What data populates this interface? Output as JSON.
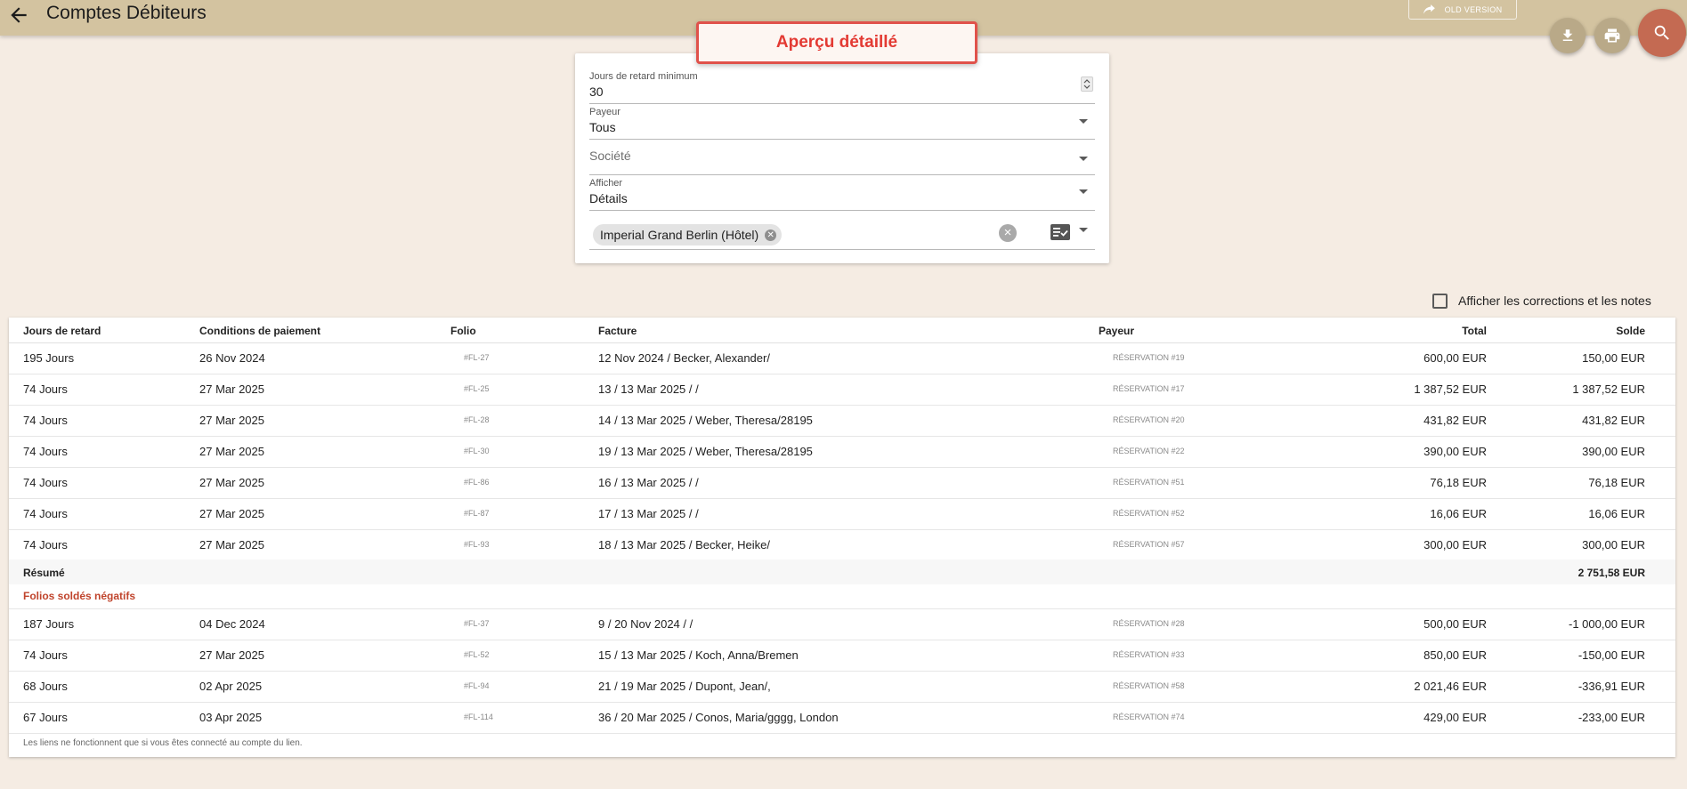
{
  "header": {
    "title": "Comptes Débiteurs",
    "old_version_label": "OLD VERSION"
  },
  "callout": {
    "text": "Aperçu détaillé"
  },
  "filters": {
    "min_days": {
      "label": "Jours de retard minimum",
      "value": "30"
    },
    "payer": {
      "label": "Payeur",
      "value": "Tous"
    },
    "company": {
      "placeholder": "Société"
    },
    "display": {
      "label": "Afficher",
      "value": "Détails"
    },
    "property_chip": "Imperial Grand Berlin (Hôtel)"
  },
  "show_notes_checkbox": {
    "label": "Afficher les corrections et les notes",
    "checked": false
  },
  "table": {
    "columns": [
      "Jours de retard",
      "Conditions de paiement",
      "Folio",
      "Facture",
      "Payeur",
      "Total",
      "Solde"
    ],
    "rows": [
      {
        "days": "195 Jours",
        "terms": "26 Nov 2024",
        "folio": "#FL-27",
        "invoice": "12 Nov 2024 / Becker, Alexander/",
        "payer": "RÉSERVATION #19",
        "total": "600,00 EUR",
        "balance": "150,00 EUR"
      },
      {
        "days": "74 Jours",
        "terms": "27 Mar 2025",
        "folio": "#FL-25",
        "invoice": "13 / 13 Mar 2025 / /",
        "payer": "RÉSERVATION #17",
        "total": "1 387,52 EUR",
        "balance": "1 387,52 EUR"
      },
      {
        "days": "74 Jours",
        "terms": "27 Mar 2025",
        "folio": "#FL-28",
        "invoice": "14 / 13 Mar 2025 / Weber, Theresa/28195",
        "payer": "RÉSERVATION #20",
        "total": "431,82 EUR",
        "balance": "431,82 EUR"
      },
      {
        "days": "74 Jours",
        "terms": "27 Mar 2025",
        "folio": "#FL-30",
        "invoice": "19 / 13 Mar 2025 / Weber, Theresa/28195",
        "payer": "RÉSERVATION #22",
        "total": "390,00 EUR",
        "balance": "390,00 EUR"
      },
      {
        "days": "74 Jours",
        "terms": "27 Mar 2025",
        "folio": "#FL-86",
        "invoice": "16 / 13 Mar 2025 / /",
        "payer": "RÉSERVATION #51",
        "total": "76,18 EUR",
        "balance": "76,18 EUR"
      },
      {
        "days": "74 Jours",
        "terms": "27 Mar 2025",
        "folio": "#FL-87",
        "invoice": "17 / 13 Mar 2025 / /",
        "payer": "RÉSERVATION #52",
        "total": "16,06 EUR",
        "balance": "16,06 EUR"
      },
      {
        "days": "74 Jours",
        "terms": "27 Mar 2025",
        "folio": "#FL-93",
        "invoice": "18 / 13 Mar 2025 / Becker, Heike/",
        "payer": "RÉSERVATION #57",
        "total": "300,00 EUR",
        "balance": "300,00 EUR"
      }
    ],
    "summary": {
      "label": "Résumé",
      "total": "2 751,58 EUR"
    },
    "negative_section_title": "Folios soldés négatifs",
    "negative_rows": [
      {
        "days": "187 Jours",
        "terms": "04 Dec 2024",
        "folio": "#FL-37",
        "invoice": "9 / 20 Nov 2024 / /",
        "payer": "RÉSERVATION #28",
        "total": "500,00 EUR",
        "balance": "-1 000,00 EUR"
      },
      {
        "days": "74 Jours",
        "terms": "27 Mar 2025",
        "folio": "#FL-52",
        "invoice": "15 / 13 Mar 2025 / Koch, Anna/Bremen",
        "payer": "RÉSERVATION #33",
        "total": "850,00 EUR",
        "balance": "-150,00 EUR"
      },
      {
        "days": "68 Jours",
        "terms": "02 Apr 2025",
        "folio": "#FL-94",
        "invoice": "21 / 19 Mar 2025 / Dupont, Jean/,",
        "payer": "RÉSERVATION #58",
        "total": "2 021,46 EUR",
        "balance": "-336,91 EUR"
      },
      {
        "days": "67 Jours",
        "terms": "03 Apr 2025",
        "folio": "#FL-114",
        "invoice": "36 / 20 Mar 2025 / Conos, Maria/gggg, London",
        "payer": "RÉSERVATION #74",
        "total": "429,00 EUR",
        "balance": "-233,00 EUR"
      }
    ],
    "footnote": "Les liens ne fonctionnent que si vous êtes connecté au compte du lien."
  },
  "icons": {
    "back": "arrow-left-icon",
    "old_version": "share-arrow-icon",
    "download": "download-icon",
    "print": "printer-icon",
    "search": "search-icon",
    "chip_remove": "close-circle-icon",
    "clear_all": "close-circle-icon",
    "list": "checklist-icon"
  },
  "colors": {
    "topbar": "#d3c3a0",
    "background": "#f5ece3",
    "search_fab": "#c46a52",
    "callout_border": "#e0524b",
    "negative_title": "#c0442c"
  }
}
